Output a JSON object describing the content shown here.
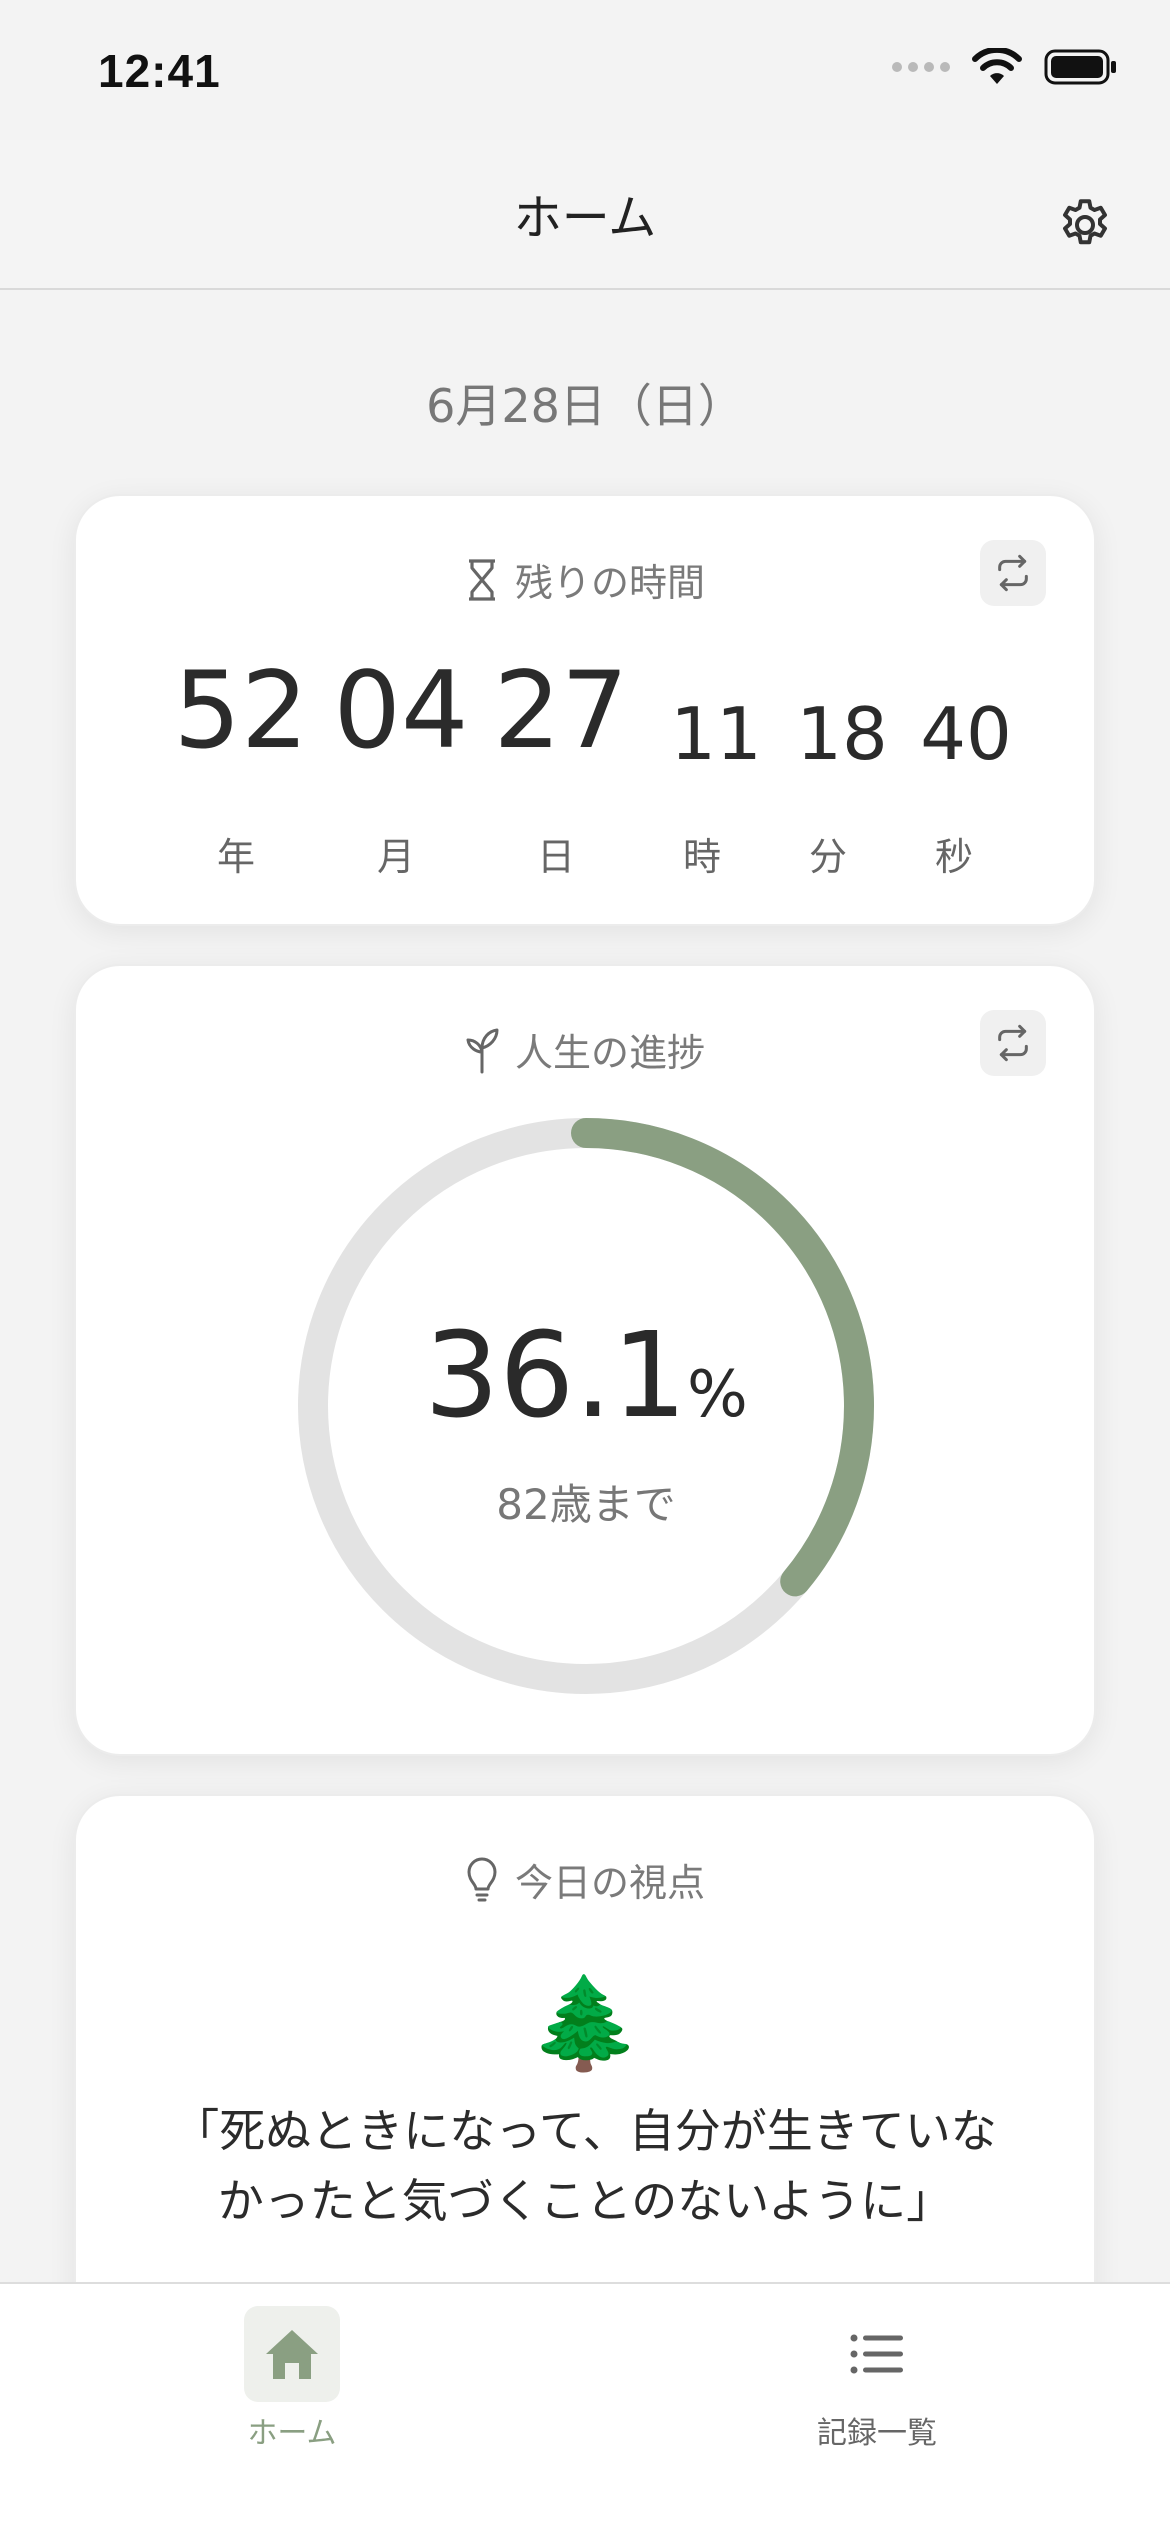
{
  "status": {
    "time": "12:41"
  },
  "nav": {
    "title": "ホーム"
  },
  "date_label": "6月28日（日）",
  "remaining": {
    "title": "残りの時間",
    "years": "52",
    "months": "04",
    "days": "27",
    "hours": "11",
    "minutes": "18",
    "seconds": "40",
    "unit_year": "年",
    "unit_month": "月",
    "unit_day": "日",
    "unit_hour": "時",
    "unit_minute": "分",
    "unit_second": "秒"
  },
  "progress": {
    "title": "人生の進捗",
    "percent_value": "36.1",
    "percent_sign": "%",
    "fraction": 0.361,
    "until_label": "82歳まで"
  },
  "perspective": {
    "title": "今日の視点",
    "emoji": "🌲",
    "quote_line1": "「死ぬときになって、自分が生きていな",
    "quote_line2": "かったと気づくことのないように」"
  },
  "tabs": [
    {
      "label": "ホーム",
      "icon": "home-icon",
      "active": true
    },
    {
      "label": "記録一覧",
      "icon": "list-icon",
      "active": false
    }
  ],
  "colors": {
    "accent": "#8a9f82",
    "ring_track": "#e3e3e3",
    "tab_active_bg": "#eef0ec"
  }
}
